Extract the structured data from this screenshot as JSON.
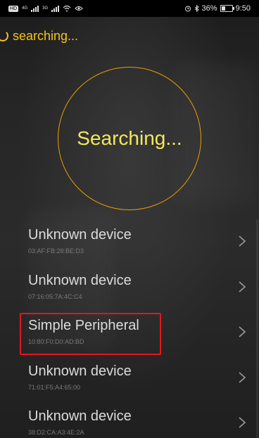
{
  "status_bar": {
    "hd_label": "HD",
    "signal1_label": "4G",
    "signal2_label": "3G",
    "battery_text": "36%",
    "time": "9:50"
  },
  "top": {
    "status_text": "searching..."
  },
  "circle": {
    "label": "Searching..."
  },
  "devices": [
    {
      "name": "Unknown device",
      "mac": "03:AF:FB:28:BE:D3"
    },
    {
      "name": "Unknown device",
      "mac": "07:16:05:7A:4C:C4"
    },
    {
      "name": "Simple Peripheral",
      "mac": "10:80:F0:D0:AD:BD"
    },
    {
      "name": "Unknown device",
      "mac": "71:01:F5:A4:65:00"
    },
    {
      "name": "Unknown device",
      "mac": "38:D2:CA:A3:4E:2A"
    }
  ],
  "colors": {
    "accent_yellow": "#f5c518",
    "circle_orange": "#e8a000",
    "highlight_red": "#e4161b"
  }
}
